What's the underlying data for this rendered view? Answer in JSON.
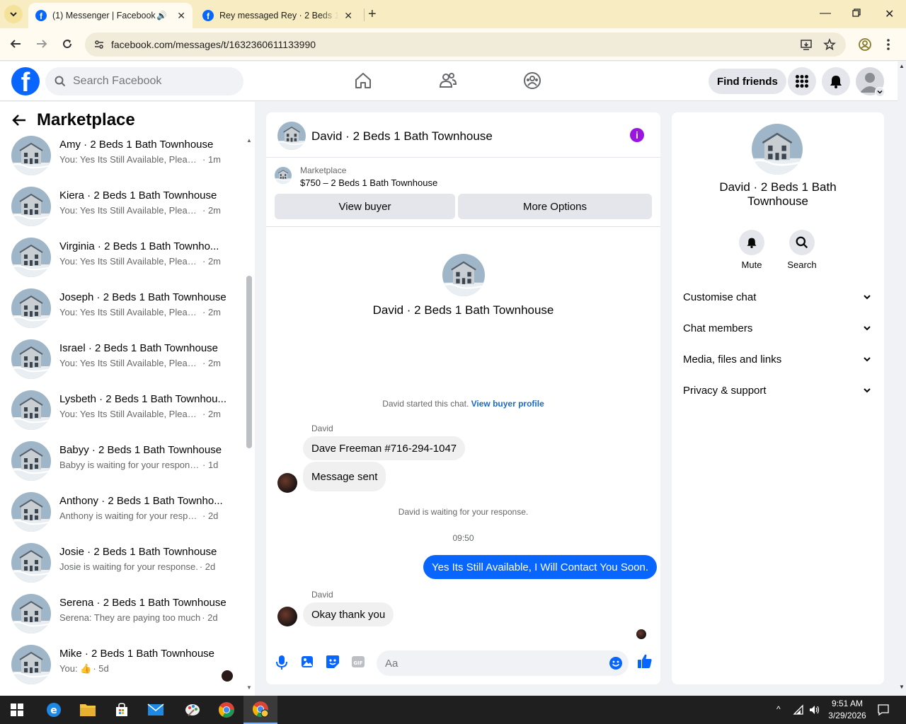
{
  "browser": {
    "tabs": [
      {
        "title": "(1) Messenger | Facebook",
        "active": true
      },
      {
        "title": "Rey messaged Rey · 2 Beds 1 Ba",
        "active": false
      }
    ],
    "url": "facebook.com/messages/t/1632360611133990"
  },
  "fb_header": {
    "logo": "f",
    "search_placeholder": "Search Facebook",
    "find_friends": "Find friends"
  },
  "left": {
    "title": "Marketplace",
    "conversations": [
      {
        "name": "Amy · 2 Beds 1 Bath Townhouse",
        "preview": "You: Yes Its Still Available, Please S...",
        "time": "· 1m"
      },
      {
        "name": "Kiera · 2 Beds 1 Bath Townhouse",
        "preview": "You: Yes Its Still Available, Please S...",
        "time": "· 2m"
      },
      {
        "name": "Virginia · 2 Beds 1 Bath Townho...",
        "preview": "You: Yes Its Still Available, Please S...",
        "time": "· 2m"
      },
      {
        "name": "Joseph · 2 Beds 1 Bath Townhouse",
        "preview": "You: Yes Its Still Available, Please S...",
        "time": "· 2m"
      },
      {
        "name": "Israel · 2 Beds 1 Bath Townhouse",
        "preview": "You: Yes Its Still Available, Please S...",
        "time": "· 2m"
      },
      {
        "name": "Lysbeth · 2 Beds 1 Bath Townhou...",
        "preview": "You: Yes Its Still Available, Please S...",
        "time": "· 2m"
      },
      {
        "name": "Babyy · 2 Beds 1 Bath Townhouse",
        "preview": "Babyy is waiting for your response.",
        "time": "· 1d"
      },
      {
        "name": "Anthony · 2 Beds 1 Bath Townho...",
        "preview": "Anthony is waiting for your respon...",
        "time": "· 2d"
      },
      {
        "name": "Josie · 2 Beds 1 Bath Townhouse",
        "preview": "Josie is waiting for your response.",
        "time": "· 2d"
      },
      {
        "name": "Serena · 2 Beds 1 Bath Townhouse",
        "preview": "Serena: They are paying too much",
        "time": "· 2d"
      },
      {
        "name": "Mike · 2 Beds 1 Bath Townhouse",
        "preview": "You: 👍",
        "time": "· 5d"
      }
    ]
  },
  "chat": {
    "title": "David · 2 Beds 1 Bath Townhouse",
    "listing_label": "Marketplace",
    "listing_price": "$750 – 2 Beds 1 Bath Townhouse",
    "view_buyer": "View buyer",
    "more_options": "More Options",
    "intro_name": "David · 2 Beds 1 Bath Townhouse",
    "started_text": "David started this chat.",
    "buyer_profile_link": "View buyer profile",
    "sender_1": "David",
    "msg_1": "Dave Freeman #716-294-1047",
    "msg_2": "Message sent",
    "waiting_text": "David is waiting for your response.",
    "time_stamp": "09:50",
    "msg_me": "Yes Its Still Available,  I Will Contact You Soon.",
    "sender_2": "David",
    "msg_3": "Okay thank you",
    "input_placeholder": "Aa"
  },
  "right": {
    "name": "David · 2 Beds 1 Bath Townhouse",
    "mute": "Mute",
    "search": "Search",
    "sections": [
      "Customise chat",
      "Chat members",
      "Media, files and links",
      "Privacy & support"
    ]
  },
  "taskbar": {
    "time": "9:51 AM",
    "date": "3/29/2026"
  },
  "colors": {
    "fb_blue": "#0866ff",
    "info_purple": "#9b14e0",
    "tab_strip": "#f7ecc2"
  }
}
